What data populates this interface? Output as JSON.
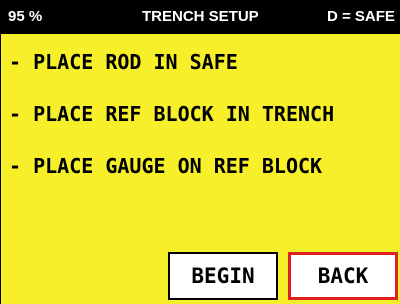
{
  "status": {
    "battery": "95 %",
    "title": "TRENCH SETUP",
    "mode": "D = SAFE"
  },
  "instructions": [
    "- PLACE ROD IN SAFE",
    "- PLACE REF BLOCK IN TRENCH",
    "- PLACE GAUGE ON REF BLOCK"
  ],
  "buttons": {
    "begin": "BEGIN",
    "back": "BACK"
  },
  "colors": {
    "panel": "#f6ef2a",
    "statusbar": "#000000",
    "back_border": "#e02020"
  }
}
